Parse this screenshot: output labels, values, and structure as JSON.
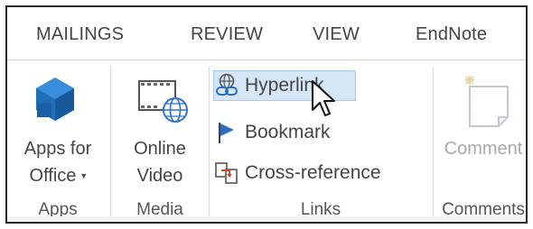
{
  "tabs": [
    {
      "label": "MAILINGS"
    },
    {
      "label": "REVIEW"
    },
    {
      "label": "VIEW"
    },
    {
      "label": "EndNote"
    }
  ],
  "groups": {
    "apps": {
      "button_line1": "Apps for",
      "button_line2": "Office",
      "label": "Apps"
    },
    "media": {
      "button_line1": "Online",
      "button_line2": "Video",
      "label": "Media"
    },
    "links": {
      "hyperlink": "Hyperlink",
      "bookmark": "Bookmark",
      "cross_reference": "Cross-reference",
      "label": "Links"
    },
    "comments": {
      "button": "Comment",
      "label": "Comments"
    }
  },
  "colors": {
    "apps_icon": "#1f6fb8",
    "hover_bg": "#d5e6f7",
    "bookmark_flag": "#2f6dbf",
    "crossref_accent": "#d24726"
  },
  "icons": {
    "apps": "apps-cube-icon",
    "media": "online-video-icon",
    "hyperlink": "hyperlink-icon",
    "bookmark": "bookmark-flag-icon",
    "cross_reference": "cross-reference-icon",
    "comment": "new-comment-icon"
  }
}
